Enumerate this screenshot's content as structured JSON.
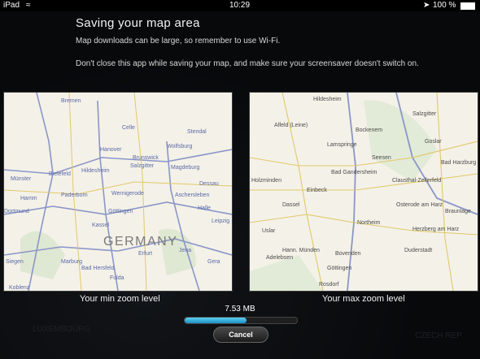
{
  "status_bar": {
    "device": "iPad",
    "time": "10:29",
    "battery": "100 %"
  },
  "header": {
    "title": "Saving your map area",
    "wifi_note": "Map downloads can be large, so remember to use Wi-Fi.",
    "screensaver_note": "Don't close this app while saving your map, and make sure your screensaver doesn't switch on."
  },
  "maps": {
    "min": {
      "caption": "Your min zoom level",
      "country_label": "GERMANY",
      "places": [
        "Bremen",
        "Hanover",
        "Hildesheim",
        "Bielefeld",
        "Paderborn",
        "Münster",
        "Hamm",
        "Dortmund",
        "Göttingen",
        "Kassel",
        "Erfurt",
        "Jena",
        "Halle (Saale)",
        "Leipzig",
        "Magdeburg",
        "Brunswick",
        "Salzgitter",
        "Wolfsburg",
        "Siegen",
        "Koblenz",
        "Marburg",
        "Fulda",
        "Gera",
        "Celle",
        "Stendal",
        "Dessau-Roßlau",
        "Wernigerode",
        "Aschersleben",
        "Bad Hersfeld"
      ]
    },
    "max": {
      "caption": "Your max zoom level",
      "places": [
        "Hildesheim",
        "Salzgitter",
        "Goslar",
        "Bad Harzburg",
        "Einbeck",
        "Northeim",
        "Göttingen",
        "Osterode am Harz",
        "Braunlage",
        "Dassel",
        "Bad Gandersheim",
        "Seesen",
        "Clausthal-Zellerfeld",
        "Holzminden",
        "Hann. Münden",
        "Duderstadt",
        "Herzberg am Harz",
        "Bovenden",
        "Alfeld (Leine)",
        "Bockenem",
        "Lamspringe",
        "Uslar",
        "Adelebsen",
        "Rosdorf"
      ]
    }
  },
  "download": {
    "size": "7.53 MB",
    "progress_percent": 55,
    "cancel_label": "Cancel"
  },
  "background_labels": [
    "LUXEMBOURG",
    "CZECH REP"
  ]
}
